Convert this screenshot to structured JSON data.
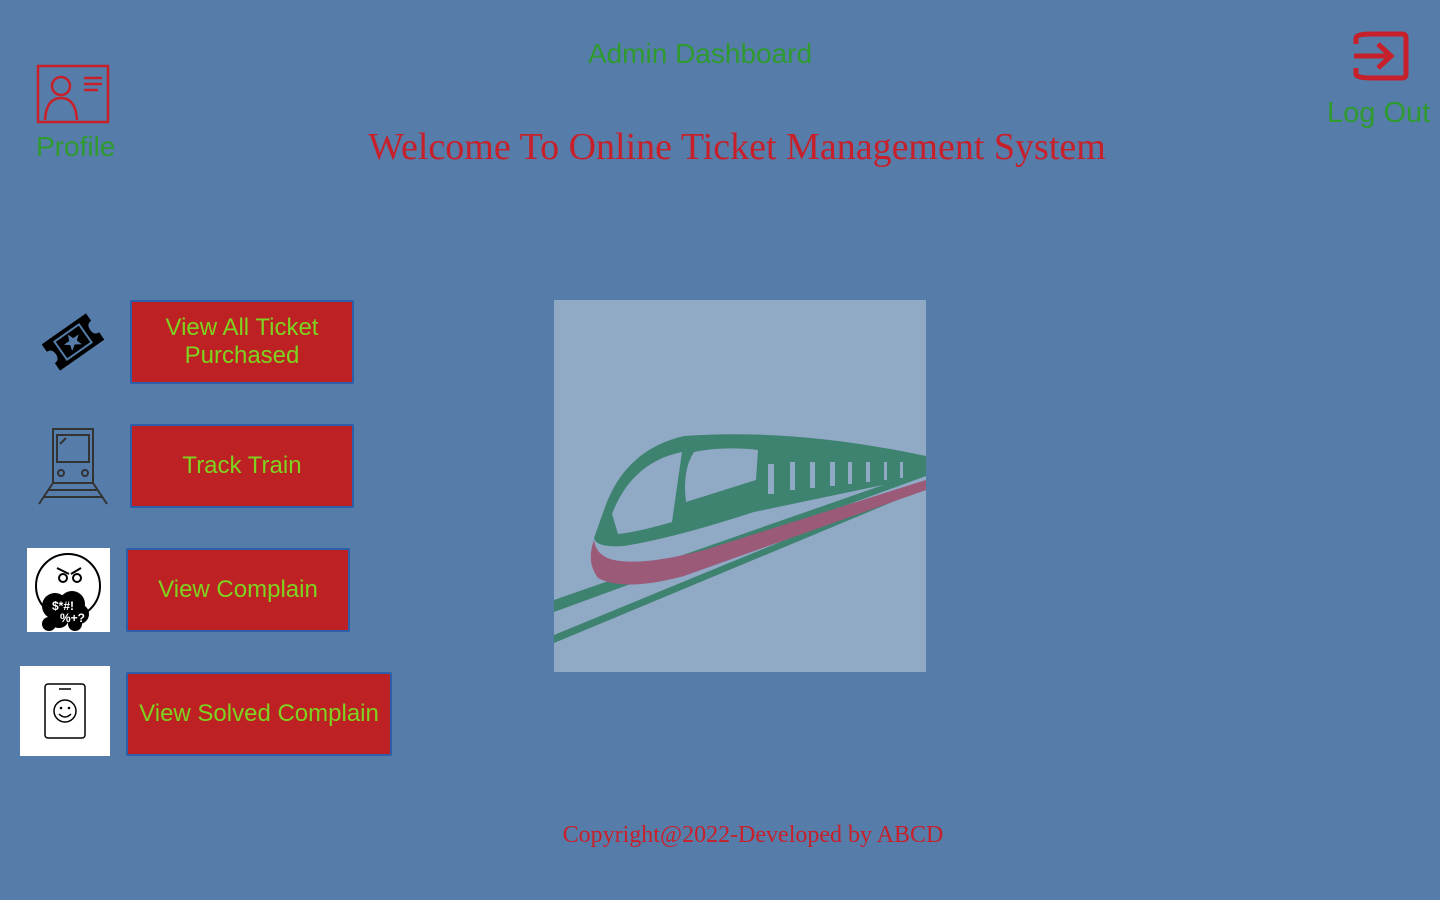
{
  "header": {
    "page_heading": "Admin Dashboard",
    "welcome_title": "Welcome To Online Ticket Management System",
    "profile_label": "Profile",
    "logout_label": "Log Out"
  },
  "actions": [
    {
      "label": "View All Ticket Purchased",
      "icon": "ticket-icon"
    },
    {
      "label": "Track Train",
      "icon": "train-track-icon"
    },
    {
      "label": "View Complain",
      "icon": "angry-face-icon"
    },
    {
      "label": "View Solved Complain",
      "icon": "smiley-clipboard-icon"
    }
  ],
  "footer": {
    "copyright": "Copyright@2022-Developed by ABCD"
  },
  "colors": {
    "background": "#567ca9",
    "heading_green": "#2f9a30",
    "title_red": "#c8202a",
    "button_red": "#bd2124",
    "button_text": "#7ed321"
  }
}
